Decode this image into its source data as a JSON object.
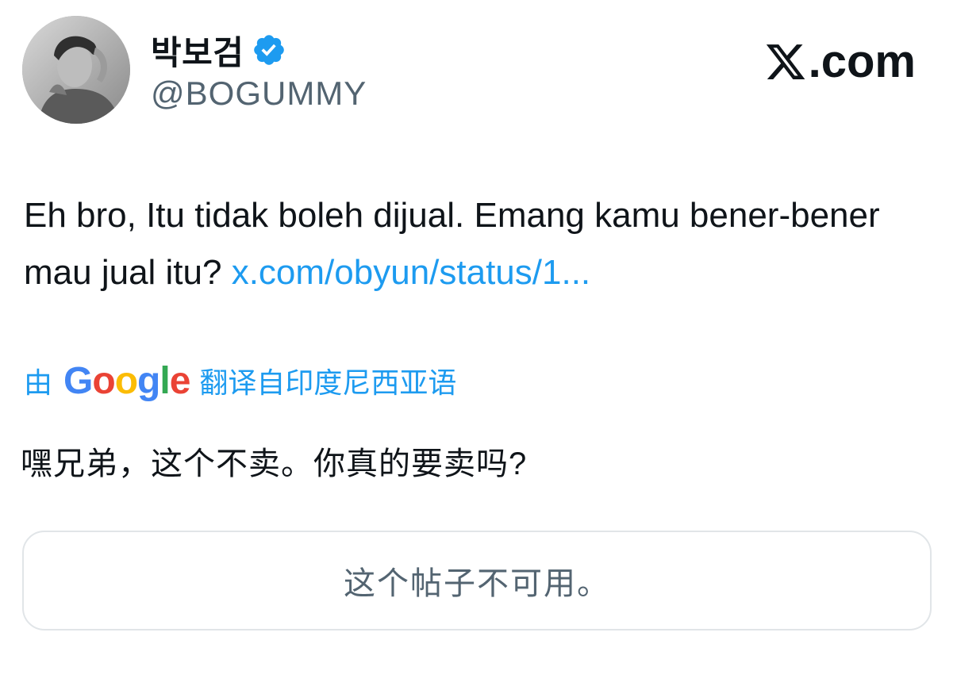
{
  "author": {
    "display_name": "박보검",
    "handle": "@BOGUMMY",
    "verified": true,
    "avatar_icon": "profile-photo"
  },
  "brand": {
    "logo_text": ".com",
    "logo_icon": "x-logo-icon"
  },
  "tweet": {
    "text": "Eh bro, Itu tidak boleh dijual. Emang kamu bener-bener mau jual itu? ",
    "link_text": "x.com/obyun/status/1..."
  },
  "translation": {
    "prefix": "由",
    "provider_parts": [
      "G",
      "o",
      "o",
      "g",
      "l",
      "e"
    ],
    "suffix": "翻译自印度尼西亚语",
    "text": "嘿兄弟，这个不卖。你真的要卖吗?"
  },
  "quoted_post": {
    "unavailable_text": "这个帖子不可用。"
  },
  "colors": {
    "link": "#1d9bf0",
    "secondary_text": "#536471",
    "google_blue": "#4285f4",
    "google_red": "#ea4335",
    "google_yellow": "#fbbc05",
    "google_green": "#34a853"
  }
}
